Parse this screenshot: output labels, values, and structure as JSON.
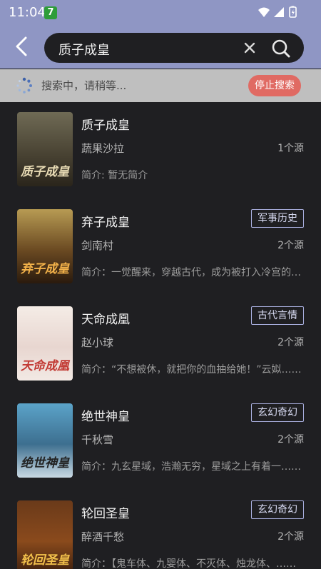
{
  "status_bar": {
    "time": "11:04",
    "notification_badge": "7"
  },
  "search": {
    "query": "质子成皇"
  },
  "progress": {
    "text": "搜索中，请稍等...",
    "stop_label": "停止搜索"
  },
  "results": [
    {
      "title": "质子成皇",
      "author": "蔬果沙拉",
      "sources": "1个源",
      "tag": "",
      "desc": "简介: 暂无简介",
      "cover_text": "质子成皇",
      "cover_bg": "linear-gradient(180deg,#6f6a55 0%,#4a4434 55%,#2a251b 100%)",
      "cover_fg": "#e9dcb5"
    },
    {
      "title": "弃子成皇",
      "author": "剑南村",
      "sources": "2个源",
      "tag": "军事历史",
      "desc": "简介：一觉醒来，穿越古代，成为被打入冷宫的废太子……",
      "cover_text": "弃子成皇",
      "cover_bg": "linear-gradient(180deg,#b79b53 0%,#6b4a22 55%,#2a1a0d 100%)",
      "cover_fg": "#f3b24a"
    },
    {
      "title": "天命成凰",
      "author": "赵小球",
      "sources": "2个源",
      "tag": "古代言情",
      "desc": "简介：“不想被休，就把你的血抽给她！”云姒……",
      "cover_text": "天命成凰",
      "cover_bg": "linear-gradient(180deg,#f4ece6 0%,#e8d6d0 55%,#f2e9e4 100%)",
      "cover_fg": "#c23a34"
    },
    {
      "title": "绝世神皇",
      "author": "千秋雪",
      "sources": "2个源",
      "tag": "玄幻奇幻",
      "desc": "简介：九玄星域，浩瀚无穷，星域之上有着一……",
      "cover_text": "绝世神皇",
      "cover_bg": "linear-gradient(180deg,#5ba3c9 0%,#3d6f8f 55%,#c9d9e3 100%)",
      "cover_fg": "#222222"
    },
    {
      "title": "轮回圣皇",
      "author": "醉酒千愁",
      "sources": "2个源",
      "tag": "玄幻奇幻",
      "desc": "简介：【鬼车体、九婴体、不灭体、烛龙体、……",
      "cover_text": "轮回圣皇",
      "cover_bg": "linear-gradient(180deg,#6a3a1a 0%,#8a4a1c 55%,#3a1e0e 100%)",
      "cover_fg": "#f2c04b"
    }
  ]
}
